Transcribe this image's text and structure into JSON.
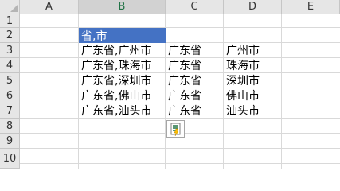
{
  "columns": [
    "A",
    "B",
    "C",
    "D",
    "E"
  ],
  "rows": [
    "1",
    "2",
    "3",
    "4",
    "5",
    "6",
    "7",
    "8",
    "9",
    "10"
  ],
  "cells": {
    "B2": "省,市",
    "B3": "广东省,广州市",
    "C3": "广东省",
    "D3": "广州市",
    "B4": "广东省,珠海市",
    "C4": "广东省",
    "D4": "珠海市",
    "B5": "广东省,深圳市",
    "C5": "广东省",
    "D5": "深圳市",
    "B6": "广东省,佛山市",
    "C6": "广东省",
    "D6": "佛山市",
    "B7": "广东省,汕头市",
    "C7": "广东省",
    "D7": "汕头市"
  },
  "colors": {
    "header_fill": "#4472c4",
    "header_text": "#ffffff",
    "gridline": "#d9d9d9",
    "heading_bg": "#e6e6e6"
  },
  "icons": {
    "flash_fill_options": "flash-fill-options-icon"
  }
}
